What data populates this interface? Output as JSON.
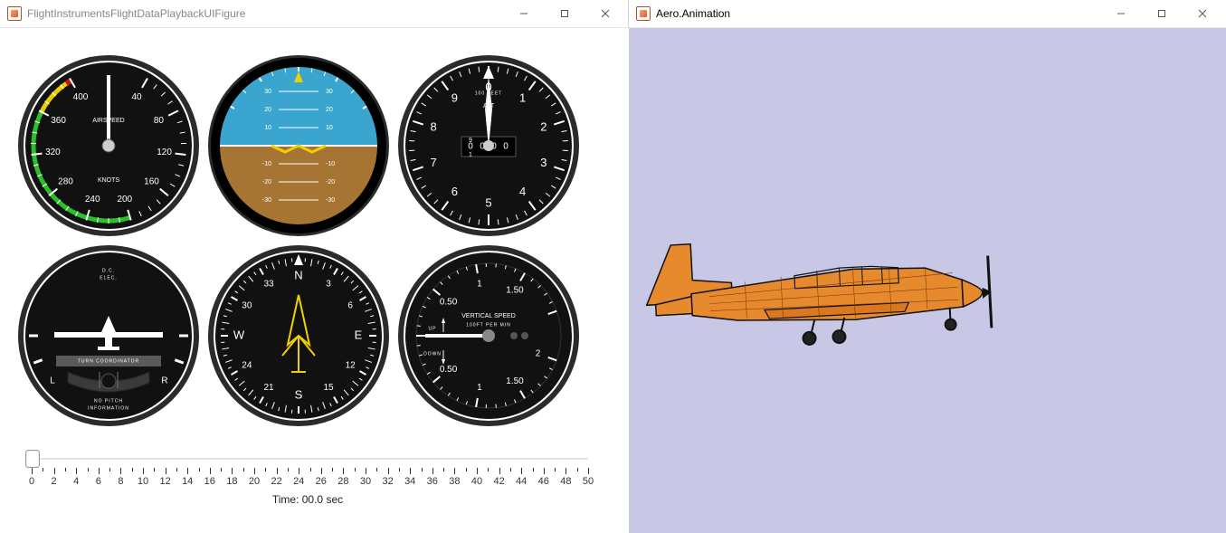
{
  "left_window": {
    "title": "FlightInstrumentsFlightDataPlaybackUIFigure",
    "slider": {
      "min": 0,
      "max": 50,
      "step_major": 2,
      "value": 0,
      "ticks": [
        0,
        2,
        4,
        6,
        8,
        10,
        12,
        14,
        16,
        18,
        20,
        22,
        24,
        26,
        28,
        30,
        32,
        34,
        36,
        38,
        40,
        42,
        44,
        46,
        48,
        50
      ]
    },
    "time_label": "Time: 00.0 sec"
  },
  "right_window": {
    "title": "Aero.Animation"
  },
  "gauges": {
    "airspeed": {
      "label_top": "AIRSPEED",
      "label_bottom": "KNOTS",
      "numbers": [
        "40",
        "80",
        "120",
        "160",
        "200",
        "240",
        "280",
        "320",
        "360",
        "400"
      ],
      "value_knots": 0,
      "arc_green_start": 200,
      "arc_green_end": 360,
      "arc_yellow_start": 360,
      "arc_yellow_end": 395,
      "redline": 395
    },
    "attitude": {
      "pitch_ticks": [
        "30",
        "20",
        "10",
        "-10",
        "-20",
        "-30"
      ],
      "pitch_deg": 0,
      "roll_deg": 0
    },
    "altimeter": {
      "label_top": "100 FEET",
      "label_center": "ALT",
      "numbers": [
        "0",
        "1",
        "2",
        "3",
        "4",
        "5",
        "6",
        "7",
        "8",
        "9"
      ],
      "drum": [
        "0",
        "9",
        "0",
        "0",
        "0",
        "1"
      ],
      "altitude_ft": 0
    },
    "turn": {
      "label_dc": "D.C.",
      "label_elec": "ELEC.",
      "label_banner": "TURN COORDINATOR",
      "label_L": "L",
      "label_R": "R",
      "label_np1": "NO PITCH",
      "label_np2": "INFORMATION"
    },
    "heading": {
      "cardinals": [
        "N",
        "E",
        "S",
        "W"
      ],
      "numbers": [
        "3",
        "6",
        "12",
        "15",
        "21",
        "24",
        "30",
        "33"
      ],
      "heading_deg": 0
    },
    "vsi": {
      "label1": "VERTICAL SPEED",
      "label2": "100FT PER MIN",
      "label_up": "UP",
      "label_down": "DOWN",
      "left_nums": [
        "0.50",
        "0.50"
      ],
      "upper_nums": [
        "1"
      ],
      "lower_nums": [
        "1"
      ],
      "right_nums": [
        "1.50",
        "2",
        "1.50"
      ],
      "value": 0
    }
  }
}
